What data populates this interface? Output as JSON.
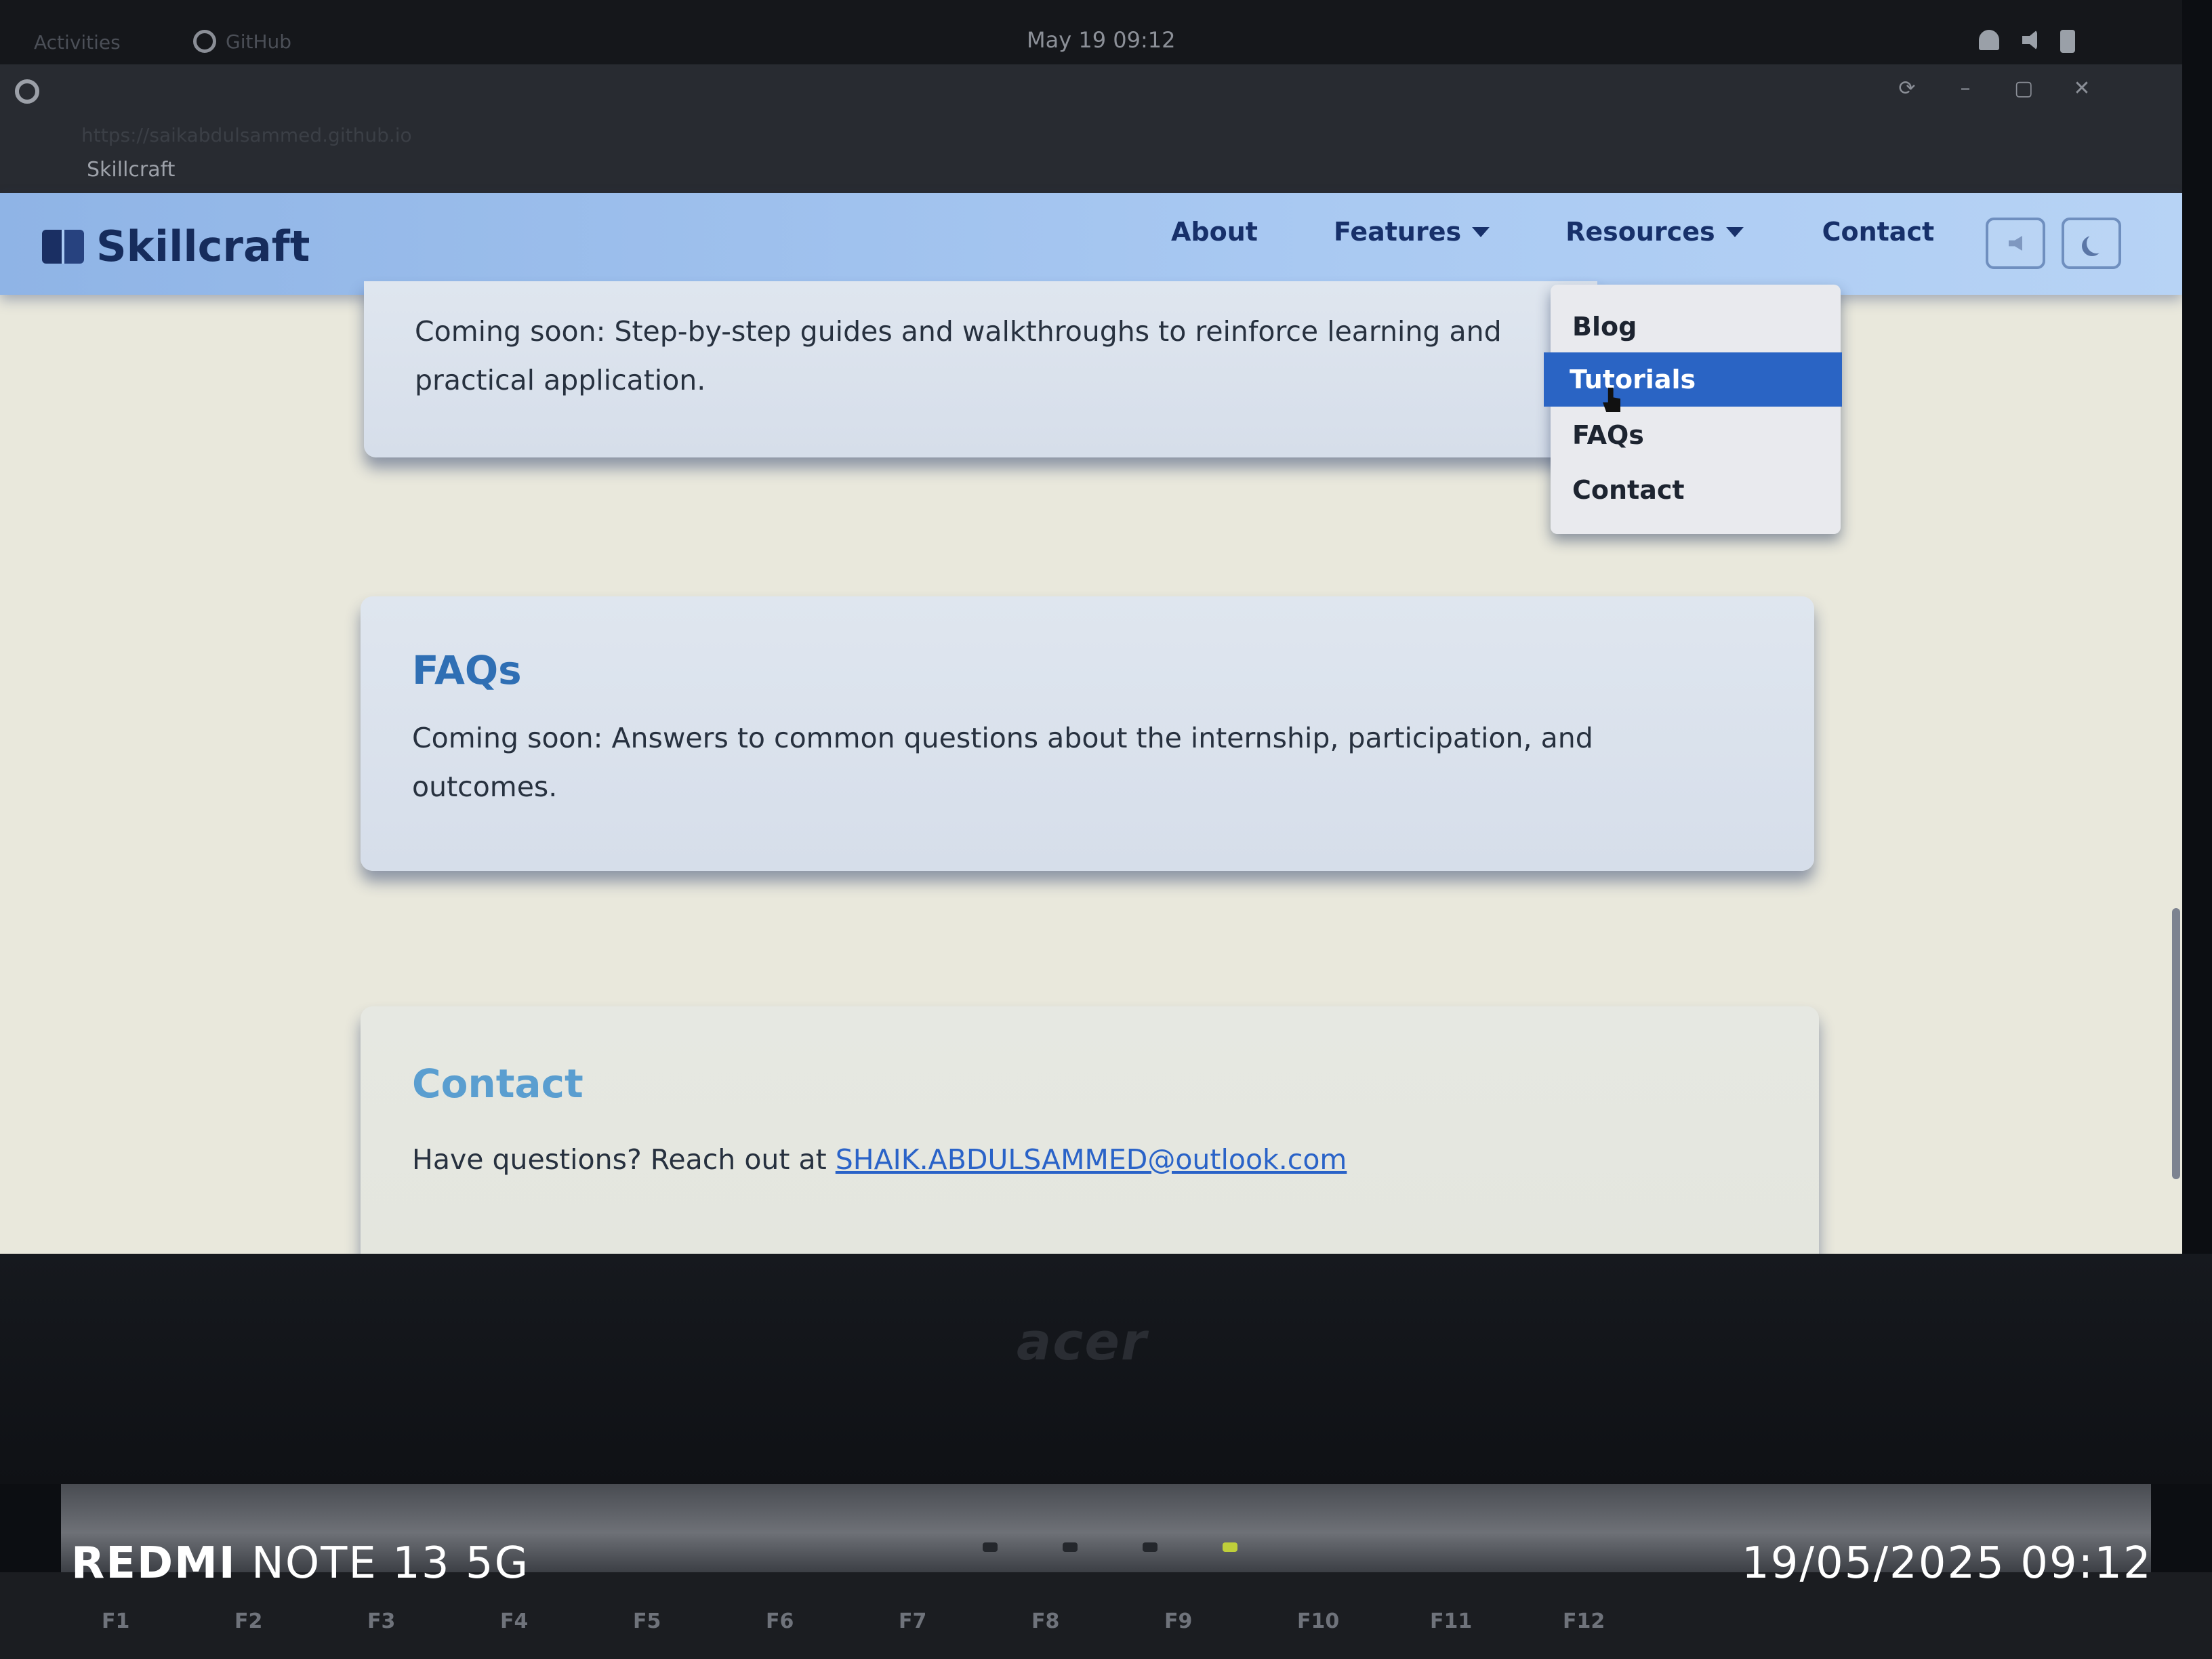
{
  "system_bar": {
    "activities": "Activities",
    "app_name": "GitHub",
    "clock": "May 19  09:12"
  },
  "browser": {
    "url": "https://saikabdulsammed.github.io",
    "tab_title": "Skillcraft"
  },
  "site": {
    "logo_text": "Skillcraft",
    "nav": {
      "about": "About",
      "features": "Features",
      "resources": "Resources",
      "contact": "Contact"
    },
    "resources_menu": {
      "blog": "Blog",
      "tutorials": "Tutorials",
      "faqs": "FAQs",
      "contact": "Contact"
    },
    "sections": {
      "tutorials_text": "Coming soon: Step-by-step guides and walkthroughs to reinforce learning and practical application.",
      "faqs_title": "FAQs",
      "faqs_text": "Coming soon: Answers to common questions about the internship, participation, and outcomes.",
      "contact_title": "Contact",
      "contact_text": "Have questions? Reach out at",
      "contact_email": "SHAIK.ABDULSAMMED@outlook.com"
    }
  },
  "laptop": {
    "brand": "acer",
    "keys": [
      "F1",
      "F2",
      "F3",
      "F4",
      "F5",
      "F6",
      "F7",
      "F8",
      "F9",
      "F10",
      "F11",
      "F12"
    ]
  },
  "photo_overlay": {
    "device_brand": "REDMI",
    "device_model": "NOTE 13 5G",
    "timestamp": "19/05/2025 09:12"
  },
  "colors": {
    "header": "#a9c9f2",
    "nav_text": "#17306a",
    "menu_highlight": "#2a64c4",
    "faqs_title": "#2f6fb4",
    "contact_title": "#5a9ed0",
    "link": "#2a63c8"
  }
}
